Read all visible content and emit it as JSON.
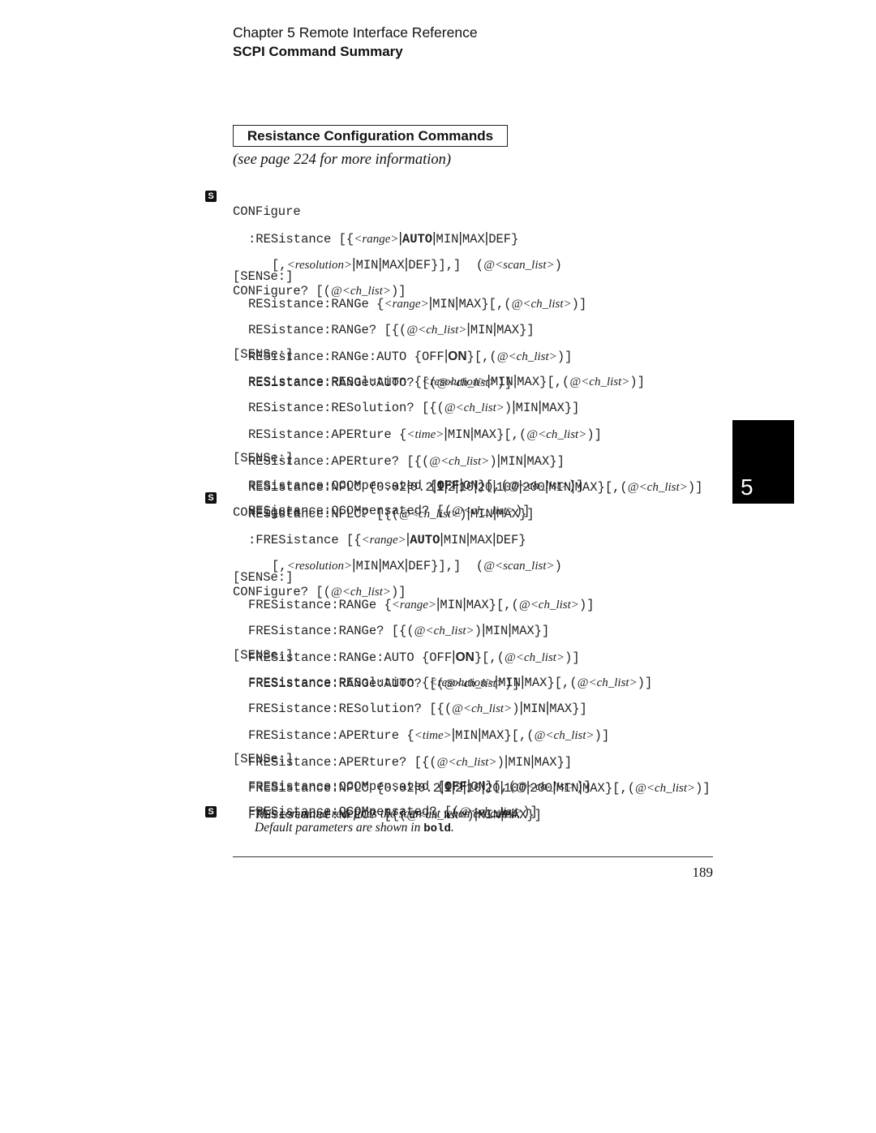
{
  "header": {
    "chapter": "Chapter 5  Remote Interface Reference",
    "section": "SCPI Command Summary"
  },
  "box_title": "Resistance Configuration Commands",
  "see_page": "(see page 224 for more information)",
  "badge_letter": "S",
  "chapter_tab": "5",
  "note": {
    "line1": "This command redefines the scan list when executed.",
    "line2_prefix": "Default parameters are shown in ",
    "line2_bold": "bold",
    "line2_suffix": "."
  },
  "page_number": "189",
  "commands": {
    "configure": "CONFigure",
    "configure_query": "CONFigure? ",
    "sense": "[SENSe:]",
    "res": {
      "function": ":RESistance ",
      "range": "RESistance:RANGe ",
      "range_q": "RESistance:RANGe? ",
      "range_auto": "RESistance:RANGe:AUTO ",
      "range_auto_q": "RESistance:RANGe:AUTO? ",
      "resolution": "RESistance:RESolution ",
      "resolution_q": "RESistance:RESolution? ",
      "aperture": "RESistance:APERture ",
      "aperture_q": "RESistance:APERture? ",
      "nplc": "RESistance:NPLC ",
      "nplc_q": "RESistance:NPLC? ",
      "ocomp": "RESistance:OCOMpensated ",
      "ocomp_q": "RESistance:OCOMpensated? "
    },
    "fres": {
      "function": ":FRESistance ",
      "range": "FRESistance:RANGe ",
      "range_q": "FRESistance:RANGe? ",
      "range_auto": "FRESistance:RANGe:AUTO ",
      "range_auto_q": "FRESistance:RANGe:AUTO? ",
      "resolution": "FRESistance:RESolution ",
      "resolution_q": "FRESistance:RESolution? ",
      "aperture": "FRESistance:APERture ",
      "aperture_q": "FRESistance:APERture? ",
      "nplc": "FRESistance:NPLC ",
      "nplc_q": "FRESistance:NPLC? ",
      "ocomp": "FRESistance:OCOMpensated ",
      "ocomp_q": "FRESistance:OCOMpensated? "
    },
    "params": {
      "range": "<range>",
      "resolution": "<resolution>",
      "time": "<time>",
      "ch_list": "<ch_list>",
      "ch_list_sp": "<ch_ list>",
      "scan_list": "<scan_list>",
      "auto": "AUTO",
      "min": "MIN",
      "max": "MAX",
      "def": "DEF",
      "off": "OFF",
      "on": "ON",
      "at": "@",
      "nplc_values": [
        "0.02",
        "0.2",
        "1",
        "2",
        "10",
        "20",
        "100",
        "200"
      ]
    }
  }
}
